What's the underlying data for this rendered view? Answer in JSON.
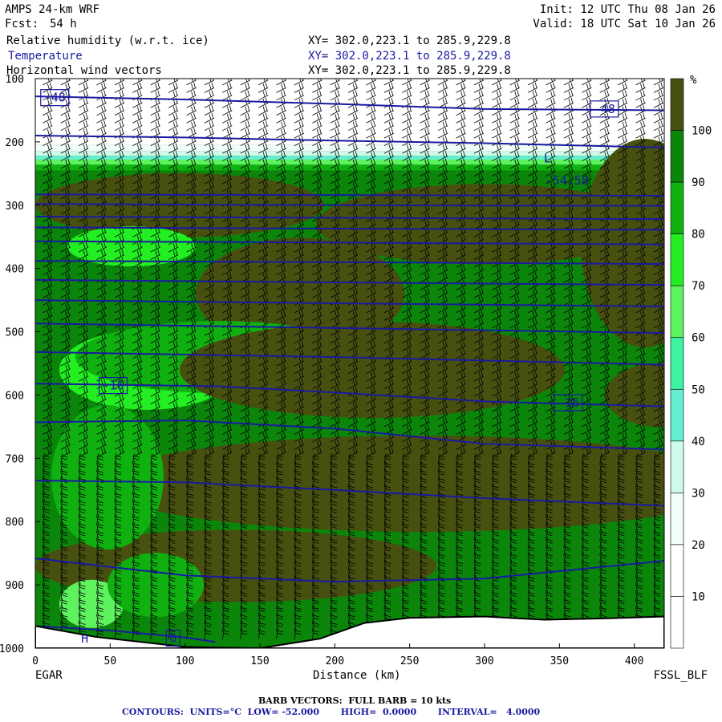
{
  "header": {
    "model": "AMPS 24-km WRF",
    "fcst_label": "Fcst:",
    "fcst_value": "54 h",
    "init": "Init: 12 UTC Thu 08 Jan 26",
    "valid": "Valid: 18 UTC Sat 10 Jan 26",
    "fields": [
      {
        "name": "Relative humidity (w.r.t. ice)",
        "xy": "XY= 302.0,223.1 to 285.9,229.8"
      },
      {
        "name": "Temperature",
        "xy": "XY= 302.0,223.1 to 285.9,229.8"
      },
      {
        "name": "Horizontal wind vectors",
        "xy": "XY= 302.0,223.1 to 285.9,229.8"
      }
    ]
  },
  "footer": {
    "left_station": "EGAR",
    "right_station": "FSSL_BLF",
    "barb_note": "BARB VECTORS:  FULL BARB = 10 kts",
    "contours_note": "CONTOURS:  UNITS=°C  LOW= -52.000       HIGH=  0.0000       INTERVAL=   4.0000"
  },
  "colors": {
    "line": "#1a1aa0",
    "ground": "#ffffff"
  },
  "chart_data": {
    "type": "heatmap",
    "xlabel": "Distance (km)",
    "ylabel": "",
    "xlim": [
      0,
      420
    ],
    "ylim": [
      1000,
      100
    ],
    "x_ticks": [
      0,
      50,
      100,
      150,
      200,
      250,
      300,
      350,
      400
    ],
    "y_ticks": [
      100,
      200,
      300,
      400,
      500,
      600,
      700,
      800,
      900,
      1000
    ],
    "colorbar": {
      "unit": "%",
      "ticks": [
        10,
        20,
        30,
        40,
        50,
        60,
        70,
        80,
        90,
        100
      ],
      "bands": [
        {
          "min": 0,
          "max": 10,
          "color": "#ffffff"
        },
        {
          "min": 10,
          "max": 20,
          "color": "#ffffff"
        },
        {
          "min": 20,
          "max": 30,
          "color": "#f0fdf8"
        },
        {
          "min": 30,
          "max": 40,
          "color": "#cffaeb"
        },
        {
          "min": 40,
          "max": 50,
          "color": "#66eed0"
        },
        {
          "min": 50,
          "max": 60,
          "color": "#3df2a0"
        },
        {
          "min": 60,
          "max": 70,
          "color": "#5ef25e"
        },
        {
          "min": 70,
          "max": 80,
          "color": "#22ee22"
        },
        {
          "min": 80,
          "max": 90,
          "color": "#11b011"
        },
        {
          "min": 90,
          "max": 100,
          "color": "#0b860b"
        },
        {
          "min": 100,
          "max": 110,
          "color": "#485010"
        }
      ]
    },
    "isotherms": [
      {
        "points": [
          [
            0,
            128
          ],
          [
            100,
            133
          ],
          [
            200,
            140
          ],
          [
            300,
            148
          ],
          [
            420,
            150
          ]
        ]
      },
      {
        "points": [
          [
            0,
            190
          ],
          [
            100,
            193
          ],
          [
            200,
            198
          ],
          [
            300,
            202
          ],
          [
            420,
            209
          ]
        ]
      },
      {
        "points": [
          [
            0,
            283
          ],
          [
            200,
            284
          ],
          [
            420,
            285
          ]
        ]
      },
      {
        "points": [
          [
            0,
            298
          ],
          [
            200,
            300
          ],
          [
            420,
            301
          ]
        ]
      },
      {
        "points": [
          [
            0,
            318
          ],
          [
            200,
            320
          ],
          [
            420,
            322
          ]
        ]
      },
      {
        "points": [
          [
            0,
            335
          ],
          [
            200,
            337
          ],
          [
            420,
            339
          ]
        ]
      },
      {
        "points": [
          [
            0,
            357
          ],
          [
            200,
            359
          ],
          [
            420,
            362
          ]
        ]
      },
      {
        "points": [
          [
            0,
            388
          ],
          [
            200,
            390
          ],
          [
            420,
            393
          ]
        ]
      },
      {
        "points": [
          [
            0,
            418
          ],
          [
            200,
            422
          ],
          [
            420,
            426
          ]
        ]
      },
      {
        "points": [
          [
            0,
            450
          ],
          [
            200,
            455
          ],
          [
            420,
            460
          ]
        ]
      },
      {
        "points": [
          [
            0,
            487
          ],
          [
            200,
            494
          ],
          [
            420,
            502
          ]
        ]
      },
      {
        "points": [
          [
            0,
            532
          ],
          [
            200,
            540
          ],
          [
            420,
            552
          ]
        ]
      },
      {
        "points": [
          [
            0,
            582
          ],
          [
            120,
            586
          ],
          [
            200,
            596
          ],
          [
            300,
            610
          ],
          [
            420,
            618
          ]
        ]
      },
      {
        "points": [
          [
            0,
            643
          ],
          [
            100,
            640
          ],
          [
            200,
            653
          ],
          [
            300,
            677
          ],
          [
            420,
            686
          ]
        ]
      },
      {
        "points": [
          [
            0,
            735
          ],
          [
            100,
            738
          ],
          [
            200,
            750
          ],
          [
            300,
            763
          ],
          [
            420,
            775
          ]
        ]
      },
      {
        "points": [
          [
            0,
            858
          ],
          [
            100,
            885
          ],
          [
            200,
            895
          ],
          [
            300,
            890
          ],
          [
            420,
            862
          ]
        ]
      },
      {
        "points": [
          [
            0,
            965
          ],
          [
            50,
            972
          ],
          [
            100,
            983
          ],
          [
            120,
            990
          ]
        ]
      }
    ],
    "contour_labels": [
      {
        "text": "-48",
        "x": 13,
        "p": 130
      },
      {
        "text": "-48",
        "x": 380,
        "p": 148
      },
      {
        "text": "-16",
        "x": 52,
        "p": 585
      },
      {
        "text": "-16",
        "x": 356,
        "p": 612
      },
      {
        "text": "0",
        "x": 92,
        "p": 984
      },
      {
        "text": "L",
        "x": 342,
        "p": 226
      },
      {
        "text": "H",
        "x": 33,
        "p": 985
      },
      {
        "text": "-54.58",
        "x": 355,
        "p": 261
      }
    ],
    "terrain": {
      "points": [
        [
          0,
          965
        ],
        [
          40,
          982
        ],
        [
          100,
          998
        ],
        [
          150,
          1000
        ],
        [
          190,
          985
        ],
        [
          220,
          960
        ],
        [
          250,
          952
        ],
        [
          300,
          950
        ],
        [
          340,
          955
        ],
        [
          380,
          953
        ],
        [
          420,
          950
        ]
      ]
    }
  }
}
